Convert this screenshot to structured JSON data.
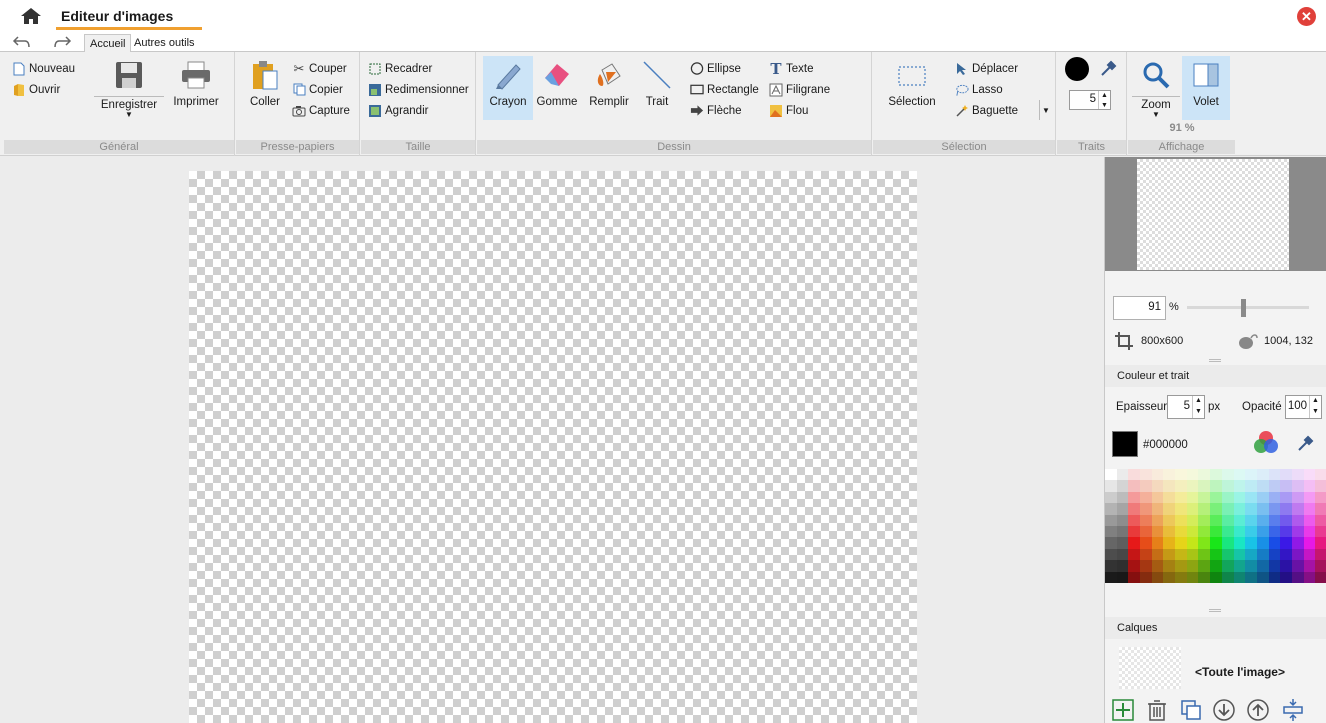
{
  "window": {
    "title": "Editeur d'images"
  },
  "tabs": [
    {
      "label": "Accueil"
    },
    {
      "label": "Autres outils"
    }
  ],
  "ribbon": {
    "general": {
      "label": "Général",
      "nouveau": "Nouveau",
      "ouvrir": "Ouvrir",
      "enregistrer": "Enregistrer",
      "imprimer": "Imprimer"
    },
    "presse_papiers": {
      "label": "Presse-papiers",
      "coller": "Coller",
      "couper": "Couper",
      "copier": "Copier",
      "capture": "Capture"
    },
    "taille": {
      "label": "Taille",
      "recadrer": "Recadrer",
      "redimensionner": "Redimensionner",
      "agrandir": "Agrandir"
    },
    "dessin": {
      "label": "Dessin",
      "crayon": "Crayon",
      "gomme": "Gomme",
      "remplir": "Remplir",
      "trait": "Trait",
      "ellipse": "Ellipse",
      "rectangle": "Rectangle",
      "fleche": "Flèche",
      "texte": "Texte",
      "filigrane": "Filigrane",
      "flou": "Flou"
    },
    "selection": {
      "label": "Sélection",
      "selection": "Sélection",
      "deplacer": "Déplacer",
      "lasso": "Lasso",
      "baguette": "Baguette"
    },
    "traits": {
      "label": "Traits",
      "size": "5"
    },
    "affichage": {
      "label": "Affichage",
      "zoom": "Zoom",
      "volet": "Volet",
      "zoom_value": "91 %"
    }
  },
  "panel": {
    "zoom_value": "91",
    "zoom_unit": "%",
    "zoom_slider_percent": 91,
    "image_size": "800x600",
    "cursor_coords": "1004, 132",
    "couleur_section": "Couleur et trait",
    "epaisseur_label": "Epaisseur",
    "epaisseur_value": "5",
    "epaisseur_unit": "px",
    "opacite_label": "Opacité",
    "opacite_value": "100",
    "color_hex": "#000000",
    "calques_section": "Calques",
    "layer_name": "<Toute l'image>"
  },
  "colors": {
    "accent": "#f0a030",
    "active_tool_bg": "#cce4f7",
    "close": "#e0403a",
    "current_color": "#000000"
  }
}
